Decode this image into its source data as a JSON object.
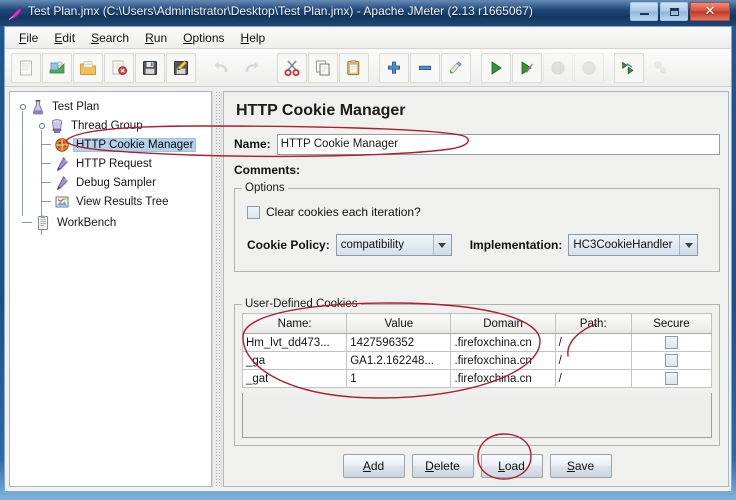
{
  "window": {
    "title": "Test Plan.jmx (C:\\Users\\Administrator\\Desktop\\Test Plan.jmx) - Apache JMeter (2.13 r1665067)",
    "app_icon": "jmeter-feather-icon",
    "controls": {
      "minimize": "minimize-button",
      "maximize": "maximize-button",
      "close_label": "✕"
    }
  },
  "menubar": {
    "items": [
      {
        "mnemonic": "F",
        "rest": "ile"
      },
      {
        "mnemonic": "E",
        "rest": "dit"
      },
      {
        "mnemonic": "S",
        "rest": "earch"
      },
      {
        "mnemonic": "R",
        "rest": "un"
      },
      {
        "mnemonic": "O",
        "rest": "ptions"
      },
      {
        "mnemonic": "H",
        "rest": "elp"
      }
    ]
  },
  "toolbar": {
    "buttons": [
      {
        "name": "new-icon",
        "enabled": true
      },
      {
        "name": "templates-icon",
        "enabled": true
      },
      {
        "name": "open-icon",
        "enabled": true
      },
      {
        "name": "close-icon",
        "enabled": true
      },
      {
        "name": "save-icon",
        "enabled": true
      },
      {
        "name": "save-as-icon",
        "enabled": true
      },
      {
        "name": "undo-icon",
        "enabled": false
      },
      {
        "name": "redo-icon",
        "enabled": false
      },
      {
        "name": "cut-icon",
        "enabled": true
      },
      {
        "name": "copy-icon",
        "enabled": true
      },
      {
        "name": "paste-icon",
        "enabled": true
      },
      {
        "name": "expand-all-icon",
        "enabled": true
      },
      {
        "name": "collapse-all-icon",
        "enabled": true
      },
      {
        "name": "toggle-icon",
        "enabled": true
      },
      {
        "name": "start-icon",
        "enabled": true
      },
      {
        "name": "start-no-pauses-icon",
        "enabled": true
      },
      {
        "name": "stop-icon",
        "enabled": false
      },
      {
        "name": "shutdown-icon",
        "enabled": false
      },
      {
        "name": "clear-icon",
        "enabled": true
      },
      {
        "name": "clear-all-icon",
        "enabled": false
      }
    ]
  },
  "tree": {
    "nodes": [
      {
        "label": "Test Plan",
        "depth": 0,
        "icon": "test-plan-icon",
        "selected": false,
        "expander": true
      },
      {
        "label": "Thread Group",
        "depth": 1,
        "icon": "thread-group-icon",
        "selected": false,
        "expander": true
      },
      {
        "label": "HTTP Cookie Manager",
        "depth": 2,
        "icon": "cookie-manager-icon",
        "selected": true,
        "expander": false
      },
      {
        "label": "HTTP Request",
        "depth": 2,
        "icon": "http-request-icon",
        "selected": false,
        "expander": false
      },
      {
        "label": "Debug Sampler",
        "depth": 2,
        "icon": "debug-sampler-icon",
        "selected": false,
        "expander": false
      },
      {
        "label": "View Results Tree",
        "depth": 2,
        "icon": "view-results-tree-icon",
        "selected": false,
        "expander": false
      },
      {
        "label": "WorkBench",
        "depth": 0,
        "icon": "workbench-icon",
        "selected": false,
        "expander": false
      }
    ]
  },
  "panel": {
    "title": "HTTP Cookie Manager",
    "name_label": "Name:",
    "name_value": "HTTP Cookie Manager",
    "comments_label": "Comments:",
    "comments_value": "",
    "options": {
      "legend": "Options",
      "clear_cookies_label": "Clear cookies each iteration?",
      "clear_cookies_checked": false,
      "cookie_policy_label": "Cookie Policy:",
      "cookie_policy_value": "compatibility",
      "implementation_label": "Implementation:",
      "implementation_value": "HC3CookieHandler"
    },
    "cookies": {
      "legend": "User-Defined Cookies",
      "columns": [
        "Name:",
        "Value",
        "Domain",
        "Path:",
        "Secure"
      ],
      "rows": [
        {
          "name": "Hm_lvt_dd473...",
          "value": "1427596352",
          "domain": ".firefoxchina.cn",
          "path": "/",
          "secure": false
        },
        {
          "name": "_ga",
          "value": "GA1.2.162248...",
          "domain": ".firefoxchina.cn",
          "path": "/",
          "secure": false
        },
        {
          "name": "_gat",
          "value": "1",
          "domain": ".firefoxchina.cn",
          "path": "/",
          "secure": false
        }
      ]
    },
    "buttons": [
      {
        "mnemonic": "A",
        "rest": "dd",
        "name": "add-button"
      },
      {
        "mnemonic": "D",
        "rest": "elete",
        "name": "delete-button"
      },
      {
        "mnemonic": "L",
        "rest": "oad",
        "name": "load-button",
        "highlighted": true
      },
      {
        "mnemonic": "S",
        "rest": "ave",
        "name": "save-button"
      }
    ]
  },
  "annotations": {
    "color": "#aa1f31",
    "shapes": [
      "ellipse-over-tree-and-name-field",
      "ellipse-over-cookie-table",
      "circle-around-load-button"
    ]
  },
  "colors": {
    "titlebar": "#1c4677",
    "close_button": "#d9503a",
    "selection": "#b5d2ea",
    "panel_bg": "#f0f0ee",
    "annotation_red": "#aa1f31",
    "start_green": "#2e9b2e"
  }
}
